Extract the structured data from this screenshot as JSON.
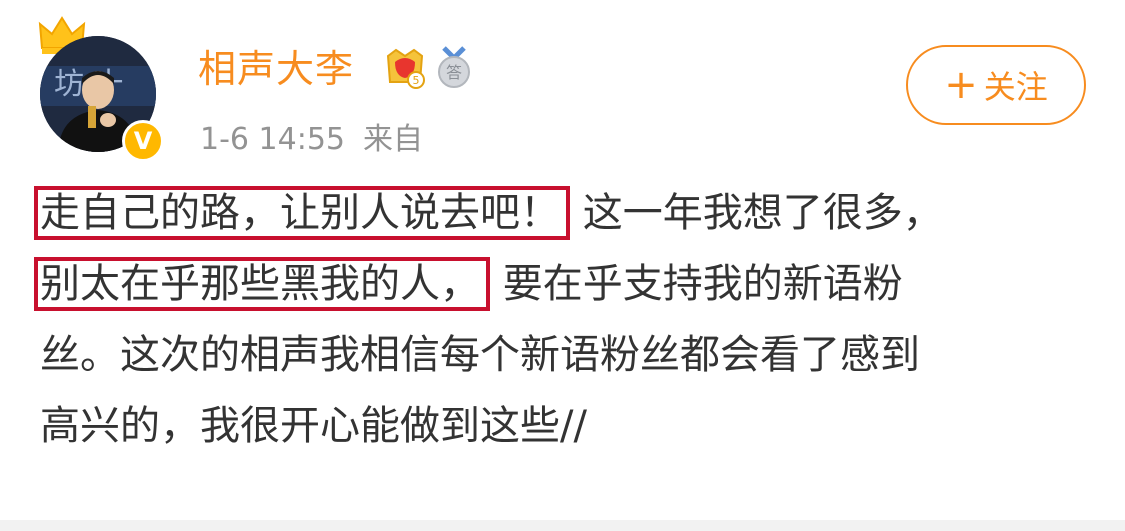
{
  "user": {
    "name": "相声大李",
    "verified_mark": "V",
    "icons": [
      "crown-icon",
      "vip-level-icon",
      "answer-medal-icon"
    ],
    "vip_level": "5",
    "medal_text": "答"
  },
  "meta": {
    "time": "1-6 14:55",
    "source": "来自"
  },
  "follow": {
    "plus": "+",
    "label": "关注"
  },
  "post": {
    "line1_highlight": "走自己的路，让别人说去吧！",
    "line1_rest": "这一年我想了很多，",
    "line2_highlight": "别太在乎那些黑我的人，",
    "line2_rest": "要在乎支持我的新语粉",
    "line3": "丝。这次的相声我相信每个新语粉丝都会看了感到",
    "line4": "高兴的，我很开心能做到这些//"
  },
  "colors": {
    "accent": "#f78c1f",
    "highlight_border": "#c8102e",
    "meta_gray": "#939393",
    "text": "#333333"
  }
}
